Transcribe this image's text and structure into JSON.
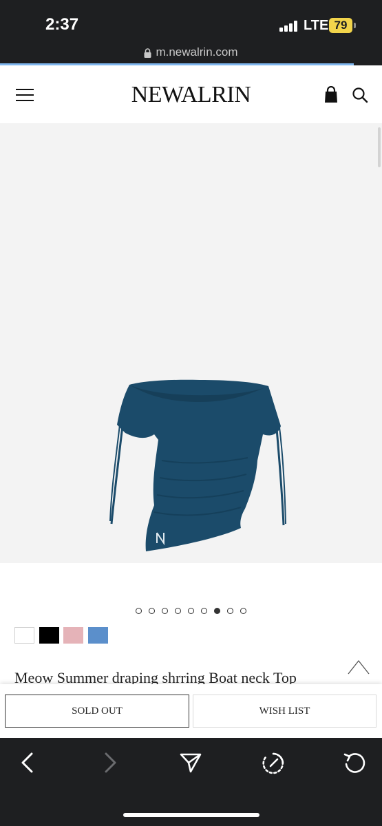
{
  "status_bar": {
    "time": "2:37",
    "network": "LTE",
    "battery": "79"
  },
  "browser": {
    "url": "m.newalrin.com"
  },
  "header": {
    "logo": "NEWALRIN",
    "menu_icon": "hamburger-icon",
    "cart_icon": "shopping-bag-icon",
    "search_icon": "search-icon"
  },
  "gallery": {
    "total_slides": 9,
    "active_slide": 7
  },
  "color_swatches": [
    "#ffffff",
    "#000000",
    "#e5b3b8",
    "#5b8fcb"
  ],
  "product": {
    "title": "Meow Summer draping shrring Boat neck Top"
  },
  "actions": {
    "sold_out_label": "SOLD OUT",
    "wish_list_label": "WISH LIST"
  },
  "browser_toolbar": {
    "icons": [
      "back-icon",
      "forward-icon",
      "share-icon",
      "speed-dial-icon",
      "reload-icon"
    ]
  }
}
